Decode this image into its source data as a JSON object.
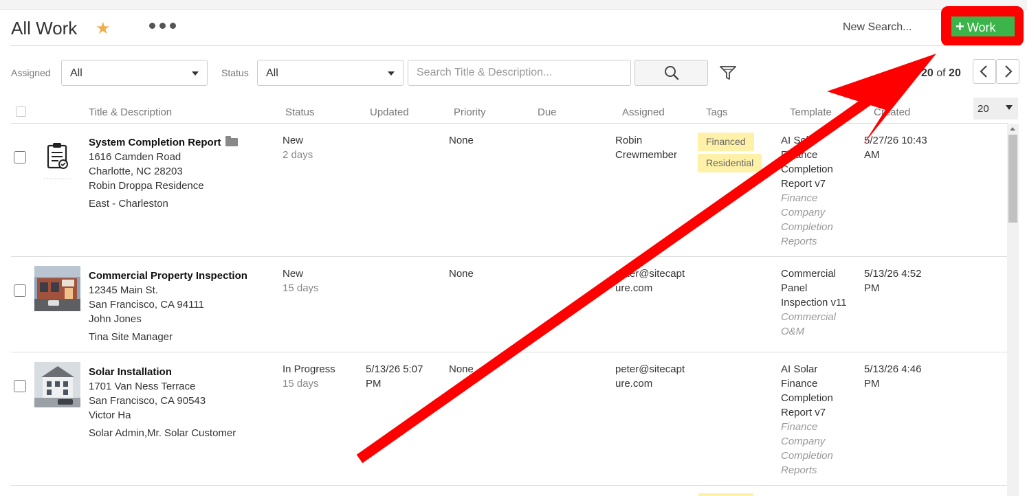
{
  "header": {
    "title": "All Work",
    "favorite_icon": "star-icon",
    "more_icon": "more-dots-icon",
    "new_search": "New Search...",
    "add_work_label": "Work",
    "add_icon": "plus-icon",
    "highlight_color": "#ff0000",
    "accent_green": "#3bb54a"
  },
  "filters": {
    "assigned_label": "Assigned",
    "assigned_value": "All",
    "status_label": "Status",
    "status_value": "All",
    "search_placeholder": "Search Title & Description...",
    "search_icon": "search-icon",
    "filter_icon": "filter-icon"
  },
  "pagination": {
    "count": "20",
    "of": "of",
    "total": "20",
    "per_page": "20"
  },
  "columns": [
    "Title & Description",
    "Status",
    "Updated",
    "Priority",
    "Due",
    "Assigned",
    "Tags",
    "Template",
    "Created"
  ],
  "rows": [
    {
      "title": "System Completion Report",
      "address1": "1616 Camden Road",
      "address2": "Charlotte, NC 28203",
      "contact": "Robin Droppa Residence",
      "team": "East - Charleston",
      "status": "New",
      "age": "2 days",
      "updated": "",
      "priority": "None",
      "due": "",
      "assigned": [
        "Robin",
        "Crewmember"
      ],
      "tags": [
        "Financed",
        "Residential"
      ],
      "template": [
        "AI Solar",
        "Finance",
        "Completion",
        "Report v7"
      ],
      "template_group": [
        "Finance",
        "Company",
        "Completion",
        "Reports"
      ],
      "created": [
        "5/27/26 10:43",
        "AM"
      ]
    },
    {
      "title": "Commercial Property Inspection",
      "address1": "12345 Main St.",
      "address2": "San Francisco, CA 94111",
      "contact": "John Jones",
      "team": "Tina Site Manager",
      "status": "New",
      "age": "15 days",
      "updated": "",
      "priority": "None",
      "due": "",
      "assigned": [
        "peter@sitecapt",
        "ure.com"
      ],
      "tags": [],
      "template": [
        "Commercial",
        "Panel",
        "Inspection v11"
      ],
      "template_group": [
        "Commercial",
        "O&M"
      ],
      "created": [
        "5/13/26 4:52",
        "PM"
      ]
    },
    {
      "title": "Solar Installation",
      "address1": "1701 Van Ness Terrace",
      "address2": "San Francisco, CA 90543",
      "contact": "Victor Ha",
      "team": "Solar Admin,Mr. Solar Customer",
      "status": "In Progress",
      "age": "15 days",
      "updated": [
        "5/13/26 5:07",
        "PM"
      ],
      "priority": "None",
      "due": "",
      "assigned": [
        "peter@sitecapt",
        "ure.com"
      ],
      "tags": [],
      "template": [
        "AI Solar",
        "Finance",
        "Completion",
        "Report v7"
      ],
      "template_group": [
        "Finance",
        "Company",
        "Completion",
        "Reports"
      ],
      "created": [
        "5/13/26 4:46",
        "PM"
      ]
    }
  ]
}
